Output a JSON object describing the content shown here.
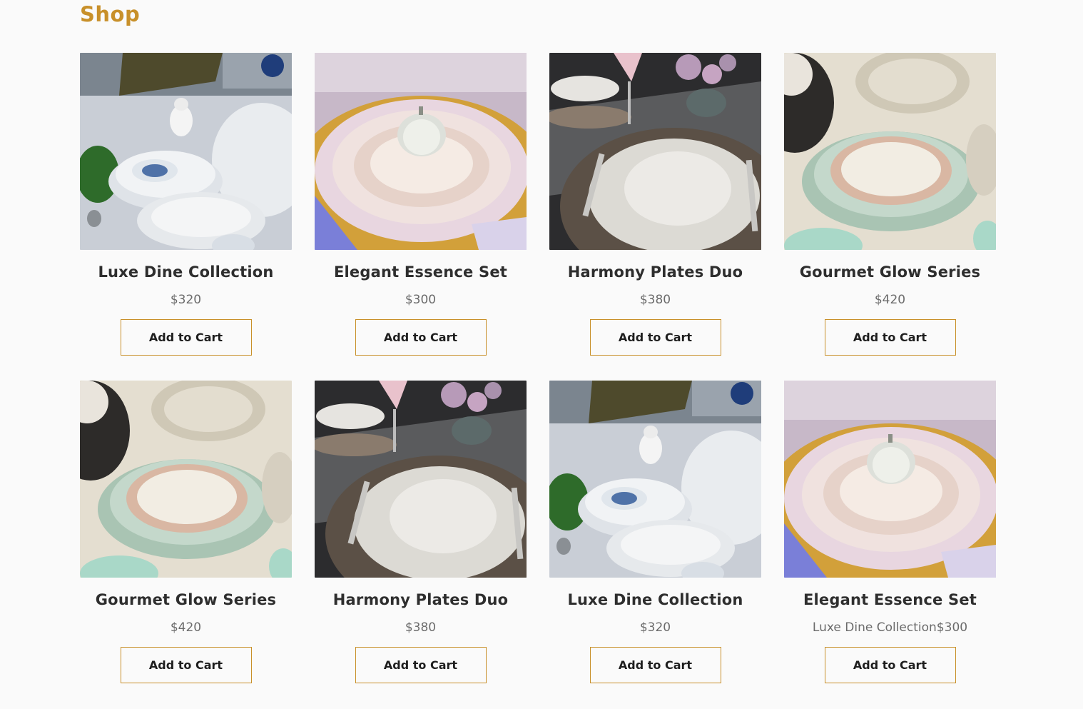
{
  "page": {
    "title": "Shop"
  },
  "colors": {
    "accent": "#c8902a",
    "text": "#2e2e2e",
    "price": "#6b6b6b",
    "background": "#fafafa"
  },
  "products": [
    {
      "name": "Luxe Dine Collection",
      "price": "$320",
      "button": "Add to Cart",
      "image": "luxe-dine-photo"
    },
    {
      "name": "Elegant Essence Set",
      "price": "$300",
      "button": "Add to Cart",
      "image": "elegant-essence-photo"
    },
    {
      "name": "Harmony Plates Duo",
      "price": "$380",
      "button": "Add to Cart",
      "image": "harmony-plates-photo"
    },
    {
      "name": "Gourmet Glow Series",
      "price": "$420",
      "button": "Add to Cart",
      "image": "gourmet-glow-photo"
    },
    {
      "name": "Gourmet Glow Series",
      "price": "$420",
      "button": "Add to Cart",
      "image": "gourmet-glow-photo"
    },
    {
      "name": "Harmony Plates Duo",
      "price": "$380",
      "button": "Add to Cart",
      "image": "harmony-plates-photo"
    },
    {
      "name": "Luxe Dine Collection",
      "price": "$320",
      "button": "Add to Cart",
      "image": "luxe-dine-photo"
    },
    {
      "name": "Elegant Essence Set",
      "price": "Luxe Dine Collection$300",
      "button": "Add to Cart",
      "image": "elegant-essence-photo"
    }
  ]
}
